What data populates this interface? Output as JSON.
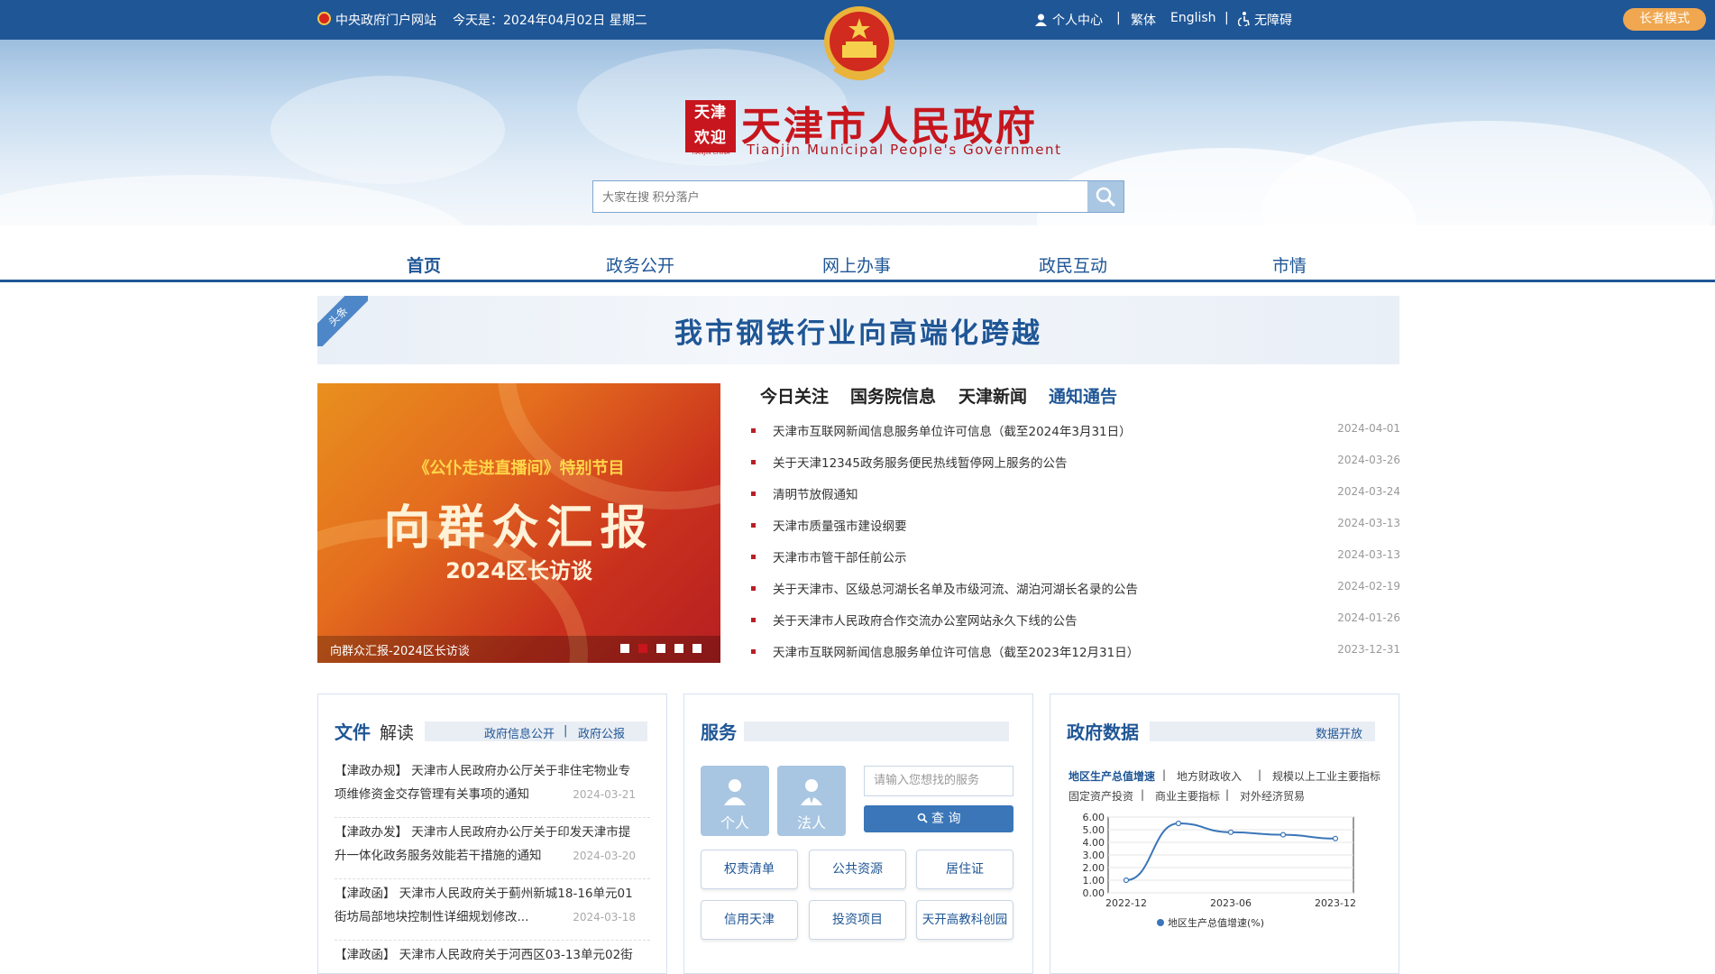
{
  "topbar": {
    "gov_portal": "中央政府门户网站",
    "today_label": "今天是：2024年04月02日 星期二",
    "user_center": "个人中心",
    "traditional": "繁体",
    "english": "English",
    "accessibility": "无障碍",
    "elder_mode": "长者模式"
  },
  "header": {
    "seal_text": "天津\n欢迎",
    "seal_caption": "TIANJIN·CHINA",
    "title": "天津市人民政府",
    "subtitle": "Tianjin Municipal People's Government"
  },
  "search": {
    "placeholder": "大家在搜 积分落户"
  },
  "nav": {
    "items": [
      "首页",
      "政务公开",
      "网上办事",
      "政民互动",
      "市情"
    ]
  },
  "headline": {
    "tag": "头条",
    "text": "我市钢铁行业向高端化跨越"
  },
  "banner": {
    "line1": "《公仆走进直播间》特别节目",
    "line2": "向群众汇报",
    "line3": "2024区长访谈",
    "caption": "向群众汇报-2024区长访谈",
    "dots": 5,
    "active_dot": 2
  },
  "news": {
    "tabs": [
      "今日关注",
      "国务院信息",
      "天津新闻",
      "通知通告"
    ],
    "active_tab": 3,
    "items": [
      {
        "title": "天津市互联网新闻信息服务单位许可信息（截至2024年3月31日）",
        "date": "2024-04-01"
      },
      {
        "title": "关于天津12345政务服务便民热线暂停网上服务的公告",
        "date": "2024-03-26"
      },
      {
        "title": "清明节放假通知",
        "date": "2024-03-24"
      },
      {
        "title": "天津市质量强市建设纲要",
        "date": "2024-03-13"
      },
      {
        "title": "天津市市管干部任前公示",
        "date": "2024-03-13"
      },
      {
        "title": "关于天津市、区级总河湖长名单及市级河流、湖泊河湖长名录的公告",
        "date": "2024-02-19"
      },
      {
        "title": "关于天津市人民政府合作交流办公室网站永久下线的公告",
        "date": "2024-01-26"
      },
      {
        "title": "天津市互联网新闻信息服务单位许可信息（截至2023年12月31日）",
        "date": "2023-12-31"
      }
    ]
  },
  "docs": {
    "title_main": "文件",
    "title_sub": "解读",
    "link1": "政府信息公开",
    "link2": "政府公报",
    "items": [
      {
        "l1": "【津政办规】 天津市人民政府办公厅关于非住宅物业专",
        "l2": "项维修资金交存管理有关事项的通知",
        "date": "2024-03-21"
      },
      {
        "l1": "【津政办发】 天津市人民政府办公厅关于印发天津市提",
        "l2": "升一体化政务服务效能若干措施的通知",
        "date": "2024-03-20"
      },
      {
        "l1": "【津政函】 天津市人民政府关于蓟州新城18-16单元01",
        "l2": "街坊局部地块控制性详细规划修改...",
        "date": "2024-03-18"
      },
      {
        "l1": "【津政函】 天津市人民政府关于河西区03-13单元02街",
        "l2": "",
        "date": ""
      }
    ]
  },
  "service": {
    "title": "服务",
    "personal": "个人",
    "legal": "法人",
    "search_placeholder": "请输入您想找的服务",
    "query": "查 询",
    "buttons": [
      "权责清单",
      "公共资源",
      "居住证",
      "信用天津",
      "投资项目",
      "天开高教科创园"
    ]
  },
  "govdata": {
    "title": "政府数据",
    "open_link": "数据开放",
    "tabs_row1": [
      "地区生产总值增速",
      "地方财政收入",
      "规模以上工业主要指标"
    ],
    "tabs_row2": [
      "固定资产投资",
      "商业主要指标",
      "对外经济贸易"
    ],
    "active_tab": "地区生产总值增速"
  },
  "chart_data": {
    "type": "line",
    "x": [
      "2022-12",
      "2023-03",
      "2023-06",
      "2023-09",
      "2023-12"
    ],
    "x_tick_labels": [
      "2022-12",
      "2023-06",
      "2023-12"
    ],
    "series": [
      {
        "name": "地区生产总值增速(%)",
        "values": [
          1.0,
          5.5,
          4.8,
          4.6,
          4.3
        ]
      }
    ],
    "ylim": [
      0,
      6
    ],
    "y_ticks": [
      "0.00",
      "1.00",
      "2.00",
      "3.00",
      "4.00",
      "5.00",
      "6.00"
    ],
    "color": "#3a76b8",
    "legend": "bottom"
  }
}
